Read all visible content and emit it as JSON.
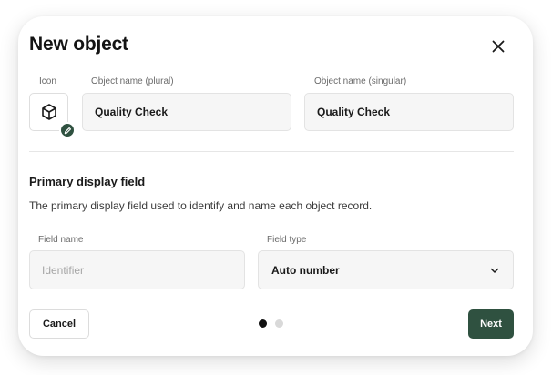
{
  "dialog": {
    "title": "New object",
    "close_icon": "close-icon"
  },
  "object": {
    "icon_label": "Icon",
    "icon_name": "cube-icon",
    "edit_icon": "pencil-icon",
    "plural_label": "Object name (plural)",
    "plural_value": "Quality Check",
    "singular_label": "Object name (singular)",
    "singular_value": "Quality Check"
  },
  "primary_display": {
    "title": "Primary display field",
    "description": "The primary display field used to identify and name each object record.",
    "field_name_label": "Field name",
    "field_name_placeholder": "Identifier",
    "field_type_label": "Field type",
    "field_type_value": "Auto number",
    "field_type_icon": "chevron-down-icon"
  },
  "footer": {
    "cancel_label": "Cancel",
    "next_label": "Next",
    "steps_total": 2,
    "current_step": 1
  },
  "colors": {
    "accent": "#2f5140",
    "step_active": "#111111",
    "step_inactive": "#d9d9d9"
  }
}
